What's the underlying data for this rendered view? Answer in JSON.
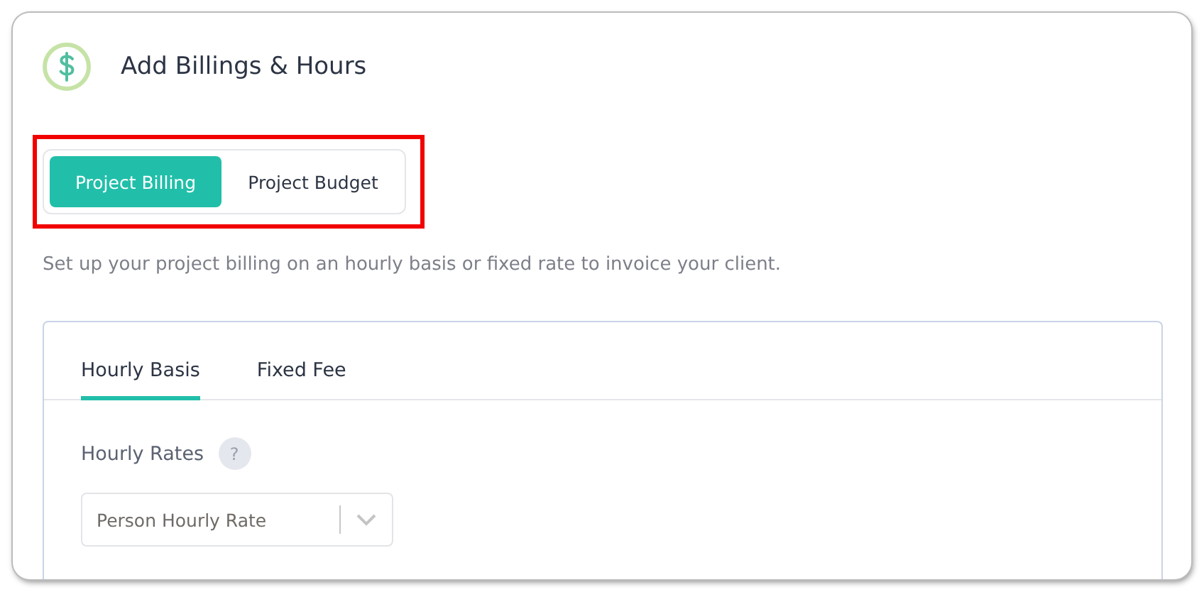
{
  "header": {
    "title": "Add Billings & Hours"
  },
  "mode_switch": [
    {
      "label": "Project Billing",
      "selected": true
    },
    {
      "label": "Project Budget",
      "selected": false
    }
  ],
  "highlight": true,
  "description": "Set up your project billing on an hourly basis or fixed rate to invoice your client.",
  "panel": {
    "tabs": [
      {
        "label": "Hourly Basis",
        "selected": true
      },
      {
        "label": "Fixed Fee",
        "selected": false
      }
    ],
    "field_label": "Hourly Rates",
    "help": "?",
    "dropdown": {
      "value": "Person Hourly Rate"
    }
  }
}
